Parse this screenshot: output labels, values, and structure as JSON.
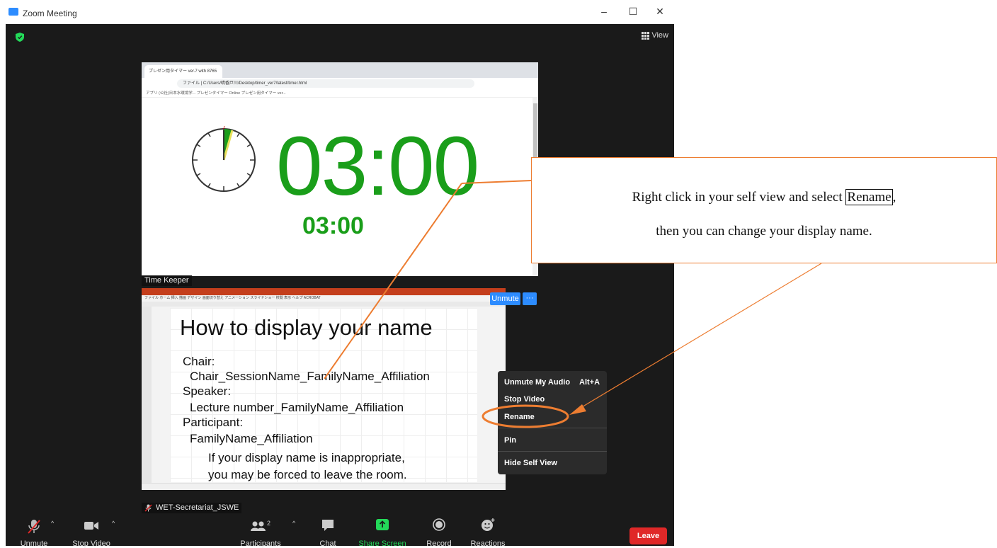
{
  "window": {
    "title": "Zoom Meeting",
    "minimize": "–",
    "maximize": "☐",
    "close": "✕"
  },
  "view_button": {
    "label": "View"
  },
  "browser": {
    "tab_title": "プレゼン用タイマー ver.7 with 8765",
    "url": "ファイル | C:/Users/晴香戸川/Desktop/timer_ver7/latest/timer.html",
    "bookmarks": "アプリ   (公社)日本水環境学...   プレゼンタイマー Online   プレゼン用タイマー ver..."
  },
  "timer": {
    "big": "03:00",
    "small": "03:00"
  },
  "tags": {
    "time_keeper": "Time Keeper",
    "self_name": "WET-Secretariat_JSWE"
  },
  "slide": {
    "title": "How to display your name",
    "lines": [
      "Chair:",
      "Chair_SessionName_FamilyName_Affiliation",
      "Speaker:",
      "Lecture number_FamilyName_Affiliation",
      "Participant:",
      "FamilyName_Affiliation",
      "If your display name is inappropriate,",
      "you may be forced to leave the room."
    ],
    "ribbon_tabs": "ファイル  ホーム  挿入  描画  デザイン  画面切り替え  アニメーション  スライドショー  校閲  表示  ヘルプ  ACROBAT"
  },
  "video_overlay": {
    "unmute": "Unmute",
    "more": "···"
  },
  "context_menu": {
    "items": [
      {
        "label": "Unmute My Audio",
        "shortcut": "Alt+A"
      },
      {
        "label": "Stop Video"
      },
      {
        "label": "Rename"
      },
      {
        "label": "Pin"
      },
      {
        "label": "Hide Self View"
      }
    ]
  },
  "toolbar": {
    "unmute": "Unmute",
    "stop_video": "Stop Video",
    "participants": "Participants",
    "participants_count": "2",
    "chat": "Chat",
    "share_screen": "Share Screen",
    "record": "Record",
    "reactions": "Reactions",
    "leave": "Leave",
    "share_color": "#23d959",
    "leave_color": "#e02828"
  },
  "annotation": {
    "line1_before": "Right click in your self view and select ",
    "line1_highlight": "Rename",
    "line1_after": ",",
    "line2": "then you can change your display name.",
    "accent_color": "#ed7d31"
  }
}
